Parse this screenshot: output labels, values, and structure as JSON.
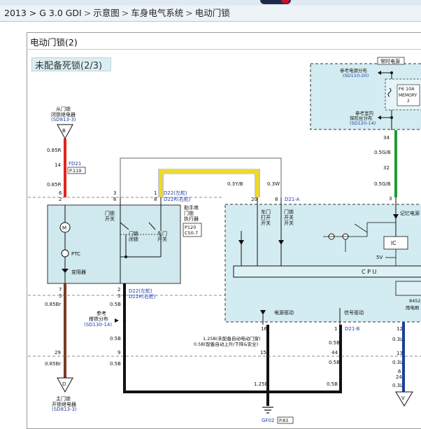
{
  "breadcrumb": [
    "2013 > G 3.0 GDI",
    "示意图",
    "车身电气系统",
    "电动门锁"
  ],
  "breadcrumb_separator": ">",
  "page": {
    "title": "电动门锁(2)",
    "subtitle": "未配备死锁(2/3)"
  },
  "colors": {
    "wire_red": "#e2231a",
    "wire_brown": "#7a3b22",
    "wire_yellow": "#f0dc18",
    "wire_green": "#1f9a3a",
    "wire_blue": "#1b3f9a",
    "box_fill": "#cfe9ee",
    "box_fill_light": "#def1f5",
    "dashed_fill": "#d3ecf1",
    "ref_text": "#1f3faa"
  },
  "labels": {
    "top_right_box_title": "常时电源",
    "ref_power_dist": "参考电源分布",
    "ref_power_dist_code": "(SD110-20)",
    "fuse_name": "F6 10A",
    "fuse_memory": "MEMORY",
    "fuse_num": "2",
    "ref_indoor_fuse_line1": "参考室内",
    "ref_indoor_fuse_line2": "保险丝分布",
    "ref_indoor_fuse_code": "(SD120-14)",
    "wire_34": "34",
    "wire_05gb_1": "0.5G/B",
    "wire_32": "32",
    "wire_05gb_2": "0.5G/B",
    "wire_3_right": "3",
    "from_door_lock_line1": "从门锁",
    "from_door_lock_line2": "闭锁继电器",
    "from_door_lock_code": "(SD813-3)",
    "conn_b_top": "B",
    "wire_085r_1": "0.85R",
    "pin_14": "14",
    "conn_fd21": "FD21",
    "conn_fd21_page": "P.119",
    "wire_085r_2": "0.85R",
    "pin_6_left": "6",
    "pin_2_left": "2",
    "pin_3_mid": "3",
    "pin_6_mid": "6",
    "pin_1": "1",
    "pin_8": "8",
    "d22_left_drive": "D22(左舵)",
    "d22r_right_drive": "D22R(右舵)",
    "passenger_line1": "助手席",
    "passenger_line2": "门锁",
    "passenger_line3": "执行器",
    "conn_p120": "P120",
    "conn_c50_7": "C50-7",
    "wire_03yb": "0.3Y/B",
    "wire_03w": "0.3W",
    "pin_20": "20",
    "pin_8_right": "8",
    "conn_d21a": "D21-A",
    "door_lock_switch_label_1": "门锁",
    "door_lock_switch_label_2": "开关",
    "door_lock_closed_1": "门锁",
    "door_lock_closed_2": "闭锁",
    "door_open_switch_1": "车门",
    "door_open_switch_2": "开关",
    "motor_label": "M",
    "ptc_label": "PTC",
    "resistor_label": "变阻器",
    "right_switch_a_1": "车门",
    "right_switch_a_2": "打开",
    "right_switch_a_3": "开关",
    "right_switch_b_1": "门锁",
    "right_switch_b_2": "开关",
    "right_switch_b_3": "开关",
    "memory_power": "记忆电源",
    "ic_label": "IC",
    "five_v": "5V",
    "cpu_label": "C P U",
    "power_drive": "电源驱动",
    "signal_drive": "信号驱动",
    "pin_7": "7",
    "pin_3_left": "3",
    "wire_085br_1": "0.85Br",
    "pin_2_bot": "2",
    "pin_3_bot": "3",
    "d22_bot_left": "D22(左舵)",
    "d22r_bot_right": "D22R(右舵)",
    "wire_05b_1": "0.5B",
    "ref_ground_1": "参考",
    "ref_ground_2": "搭铁分布",
    "ref_ground_code": "(SD130-14)",
    "wire_05b_2": "0.5B",
    "pin_16": "16",
    "pin_1_right": "1",
    "conn_d21b": "D21-B",
    "wire_125b_note_1": "1.25B(未配备自动电动门窗)",
    "wire_125b_note_2": "0.5B(配备自动上升/下降&安全)",
    "wire_05b_3": "0.5B",
    "wire_05b_4": "0.5B",
    "pin_29": "29",
    "pin_9": "9",
    "pin_15": "15",
    "pin_44": "44",
    "wire_085br_2": "0.85Br",
    "wire_05b_5": "0.5B",
    "wire_12": "12",
    "wire_03l_1": "0.3L",
    "wire_13": "13",
    "wire_03l_2": "0.3L",
    "wire_6": "6",
    "wire_24": "24",
    "wire_03l_3": "0.3L",
    "wire_125b": "1.25B",
    "wire_05b_6": "0.5B",
    "conn_d_bottom": "D",
    "main_door_line1": "主门锁",
    "main_door_line2": "开锁继电器",
    "main_door_code": "(SD813-3)",
    "ground_gf02": "GF02",
    "ground_page": "P.83",
    "right_edge_8452": "8452",
    "right_edge_rain": "雨电刷",
    "right_conn_v": "V"
  }
}
